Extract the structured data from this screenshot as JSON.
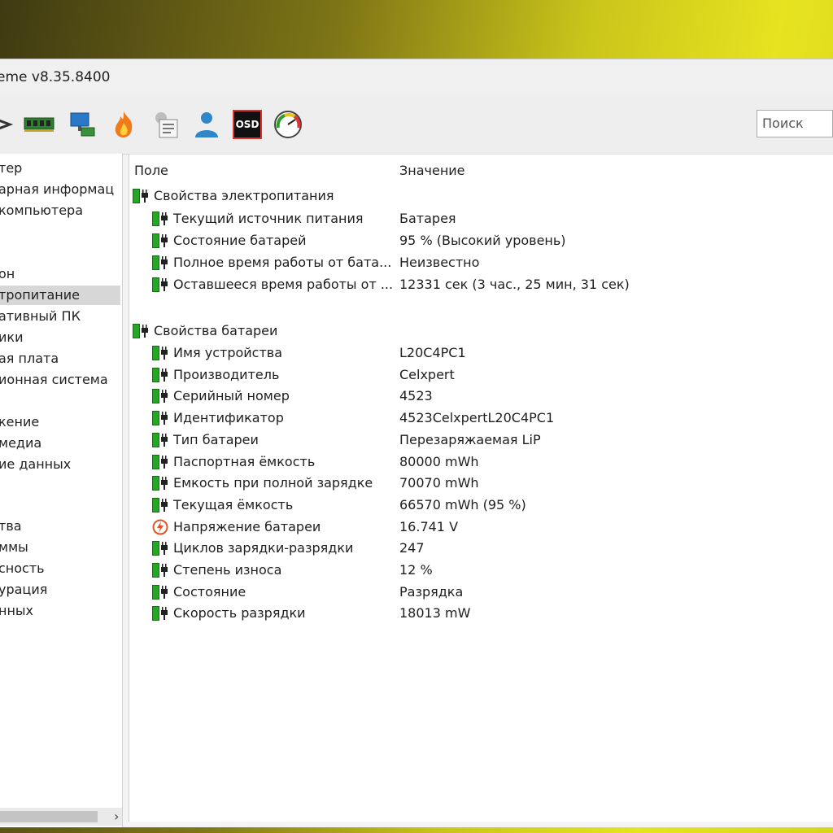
{
  "window": {
    "title": "eme v8.35.8400"
  },
  "toolbar": {
    "icons": [
      "memory-icon",
      "network-icon",
      "flame-icon",
      "report-icon",
      "user-icon",
      "osd-icon",
      "gauge-icon"
    ],
    "osd_label": "OSD",
    "search_placeholder": "Поиск"
  },
  "sidebar": {
    "items": [
      {
        "label": "тер"
      },
      {
        "label": "арная информац"
      },
      {
        "label": "компьютера"
      },
      {
        "label": "он"
      },
      {
        "label": "тропитание",
        "selected": true
      },
      {
        "label": "ативный ПК"
      },
      {
        "label": "ики"
      },
      {
        "label": "ая плата"
      },
      {
        "label": "ионная система"
      },
      {
        "label": "кение"
      },
      {
        "label": "медиа"
      },
      {
        "label": "ие данных"
      },
      {
        "label": "тва"
      },
      {
        "label": "ммы"
      },
      {
        "label": "сность"
      },
      {
        "label": "урация"
      },
      {
        "label": "нных"
      }
    ],
    "scroll_arrow": "›"
  },
  "table": {
    "col_field": "Поле",
    "col_value": "Значение",
    "power_group": {
      "title": "Свойства электропитания",
      "rows": [
        {
          "field": "Текущий источник питания",
          "value": "Батарея"
        },
        {
          "field": "Состояние батарей",
          "value": "95 % (Высокий уровень)"
        },
        {
          "field": "Полное время работы от бата...",
          "value": "Неизвестно"
        },
        {
          "field": "Оставшееся время работы от ...",
          "value": "12331 сек (3 час., 25 мин, 31 сек)"
        }
      ]
    },
    "battery_group": {
      "title": "Свойства батареи",
      "rows": [
        {
          "field": "Имя устройства",
          "value": "L20C4PC1"
        },
        {
          "field": "Производитель",
          "value": "Celxpert"
        },
        {
          "field": "Серийный номер",
          "value": "4523"
        },
        {
          "field": "Идентификатор",
          "value": "4523CelxpertL20C4PC1"
        },
        {
          "field": "Тип батареи",
          "value": "Перезаряжаемая LiP"
        },
        {
          "field": "Паспортная ёмкость",
          "value": "80000 mWh"
        },
        {
          "field": "Емкость при полной зарядке",
          "value": "70070 mWh"
        },
        {
          "field": "Текущая ёмкость",
          "value": "66570 mWh  (95 %)"
        },
        {
          "field": "Напряжение батареи",
          "value": "16.741 V"
        },
        {
          "field": "Циклов зарядки-разрядки",
          "value": "247"
        },
        {
          "field": "Степень износа",
          "value": "12 %"
        },
        {
          "field": "Состояние",
          "value": "Разрядка"
        },
        {
          "field": "Скорость разрядки",
          "value": "18013 mW"
        }
      ]
    }
  },
  "colors": {
    "battery_green": "#26a626",
    "selection": "#d7d7d7",
    "voltage_icon": "#e0542a"
  }
}
